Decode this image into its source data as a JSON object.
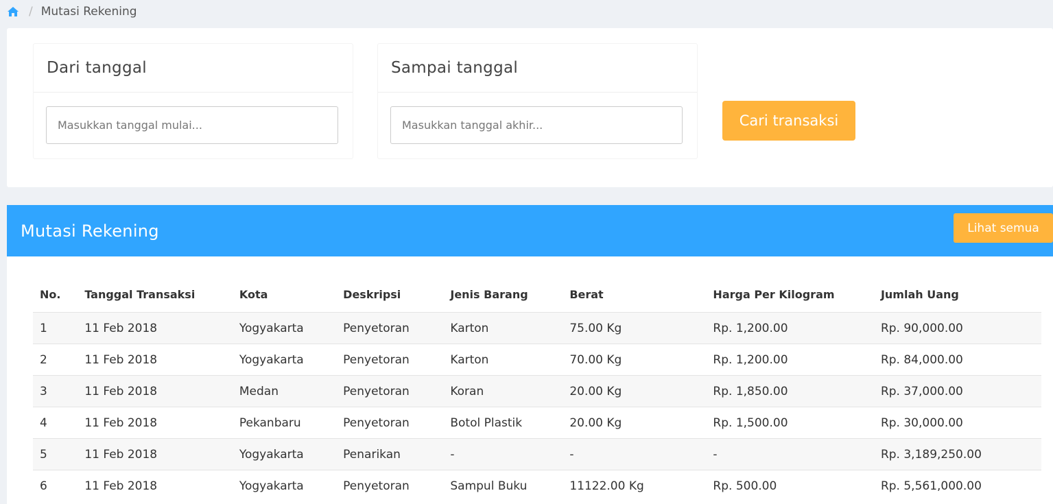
{
  "breadcrumb": {
    "separator": "/",
    "current": "Mutasi Rekening"
  },
  "filter": {
    "from_title": "Dari tanggal",
    "from_placeholder": "Masukkan tanggal mulai...",
    "to_title": "Sampai tanggal",
    "to_placeholder": "Masukkan tanggal akhir...",
    "search_label": "Cari transaksi"
  },
  "panel": {
    "title": "Mutasi Rekening",
    "view_all_label": "Lihat semua"
  },
  "table": {
    "headers": [
      "No.",
      "Tanggal Transaksi",
      "Kota",
      "Deskripsi",
      "Jenis Barang",
      "Berat",
      "Harga Per Kilogram",
      "Jumlah Uang"
    ],
    "rows": [
      [
        "1",
        "11 Feb 2018",
        "Yogyakarta",
        "Penyetoran",
        "Karton",
        "75.00 Kg",
        "Rp. 1,200.00",
        "Rp. 90,000.00"
      ],
      [
        "2",
        "11 Feb 2018",
        "Yogyakarta",
        "Penyetoran",
        "Karton",
        "70.00 Kg",
        "Rp. 1,200.00",
        "Rp. 84,000.00"
      ],
      [
        "3",
        "11 Feb 2018",
        "Medan",
        "Penyetoran",
        "Koran",
        "20.00 Kg",
        "Rp. 1,850.00",
        "Rp. 37,000.00"
      ],
      [
        "4",
        "11 Feb 2018",
        "Pekanbaru",
        "Penyetoran",
        "Botol Plastik",
        "20.00 Kg",
        "Rp. 1,500.00",
        "Rp. 30,000.00"
      ],
      [
        "5",
        "11 Feb 2018",
        "Yogyakarta",
        "Penarikan",
        "-",
        "-",
        "-",
        "Rp. 3,189,250.00"
      ],
      [
        "6",
        "11 Feb 2018",
        "Yogyakarta",
        "Penyetoran",
        "Sampul Buku",
        "11122.00 Kg",
        "Rp. 500.00",
        "Rp. 5,561,000.00"
      ]
    ]
  },
  "colors": {
    "accent_blue": "#30a5ff",
    "button_orange": "#ffb43c",
    "background": "#eef1f5"
  },
  "icons": {
    "home": "home-icon"
  }
}
